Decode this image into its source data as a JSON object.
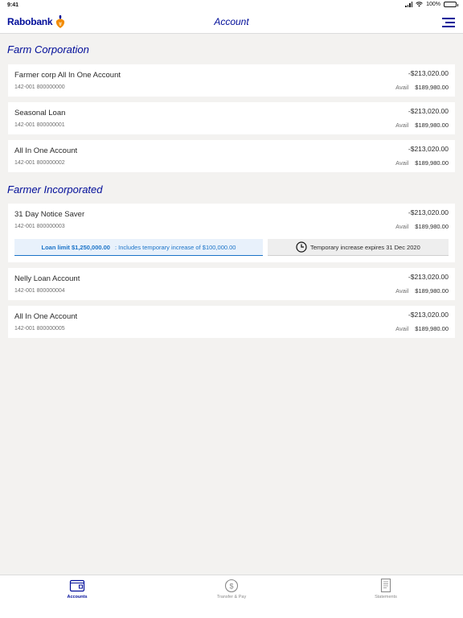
{
  "status_bar": {
    "time": "9:41",
    "battery": "100%"
  },
  "header": {
    "brand": "Rabobank",
    "title": "Account"
  },
  "groups": [
    {
      "name": "Farm Corporation",
      "accounts": [
        {
          "name": "Farmer corp All In One Account",
          "number": "142-001 800000000",
          "balance": "-$213,020.00",
          "avail_label": "Avail",
          "avail": "$189,980.00"
        },
        {
          "name": "Seasonal Loan",
          "number": "142-001 800000001",
          "balance": "-$213,020.00",
          "avail_label": "Avail",
          "avail": "$189,980.00"
        },
        {
          "name": "All In One Account",
          "number": "142-001 800000002",
          "balance": "-$213,020.00",
          "avail_label": "Avail",
          "avail": "$189,980.00"
        }
      ]
    },
    {
      "name": "Farmer Incorporated",
      "accounts": [
        {
          "name": "31 Day Notice Saver",
          "number": "142-001 800000003",
          "balance": "-$213,020.00",
          "avail_label": "Avail",
          "avail": "$189,980.00",
          "loan_limit": "Loan limit $1,250,000.00",
          "loan_note": ": Includes temporary increase of $100,000.00",
          "temp_note": "Temporary increase expires 31 Dec 2020"
        },
        {
          "name": "Nelly Loan Account",
          "number": "142-001 800000004",
          "balance": "-$213,020.00",
          "avail_label": "Avail",
          "avail": "$189,980.00"
        },
        {
          "name": "All In One Account",
          "number": "142-001 800000005",
          "balance": "-$213,020.00",
          "avail_label": "Avail",
          "avail": "$189,980.00"
        }
      ]
    }
  ],
  "tabs": [
    {
      "label": "Accounts",
      "icon": "wallet-icon",
      "active": true
    },
    {
      "label": "Transfer & Pay",
      "icon": "dollar-circle-icon",
      "active": false
    },
    {
      "label": "Statements",
      "icon": "document-icon",
      "active": false
    }
  ],
  "colors": {
    "brand_blue": "#000d99",
    "accent_blue": "#1a73c8",
    "background": "#f3f2f0",
    "logo_orange": "#f28b00"
  }
}
